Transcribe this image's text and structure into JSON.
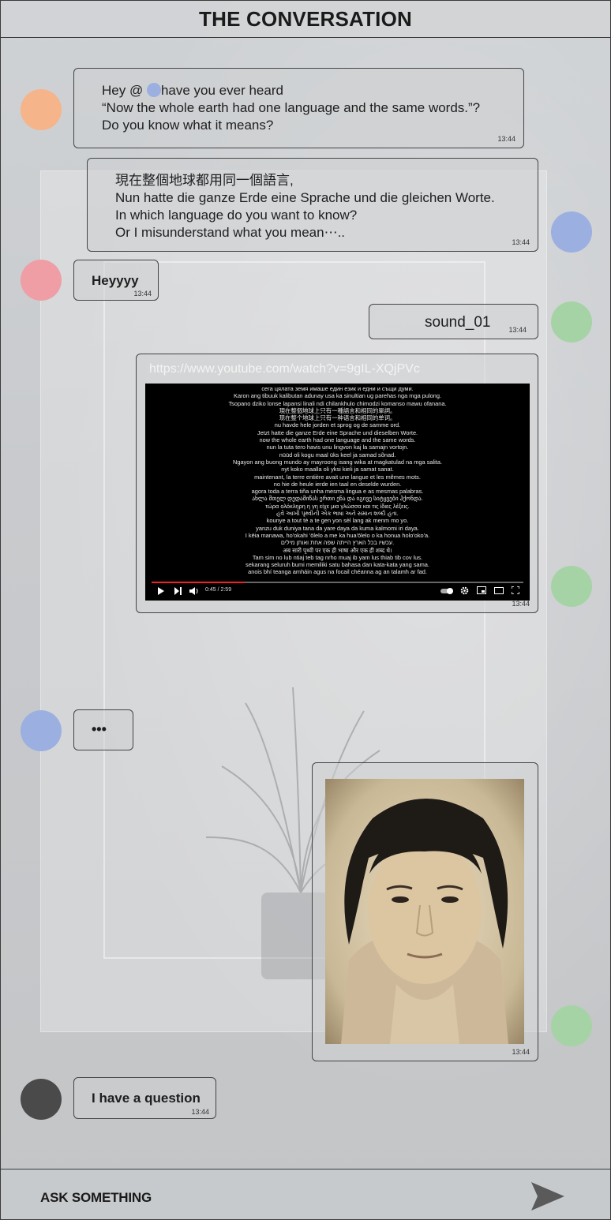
{
  "header": {
    "title": "THE CONVERSATION"
  },
  "messages": [
    {
      "time": "13:44",
      "lines": [
        "Hey @ ",
        "have you ever heard",
        "“Now the whole earth had one language and the same words.”?",
        "Do you know what it means?"
      ]
    },
    {
      "time": "13:44",
      "lines": [
        "現在整個地球都用同一個語言,",
        "Nun hatte die ganze Erde eine Sprache und die gleichen Worte.",
        "In which language do you want to know?",
        "Or I misunderstand what you mean⋯.."
      ]
    },
    {
      "time": "13:44",
      "text": "Heyyyy"
    },
    {
      "time": "13:44",
      "text": "sound_01"
    },
    {
      "time": "13:44",
      "url": "https://www.youtube.com/watch?v=9gIL-XQjPVc",
      "video_lines": [
        "сега цялата земя имаше един език и едни и същи думи.",
        "Karon ang tibuuk kalibutan adunay usa ka sinultian ug parehas nga mga pulong.",
        "Tsopano dziko lonse lapansi linali ndi chilankhulo chimodzi komanso mawu ofanana.",
        "現在整個地球上只有一種語言和相同的單詞。",
        "现在整个地球上只有一种语言和相同的单词。",
        "nu havde hele jorden et sprog og de samme ord.",
        "Jetzt hatte die ganze Erde eine Sprache und dieselben Worte.",
        "now the whole earth had one language and the same words.",
        "nun la tuta tero havis unu lingvon kaj la samajn vortojn.",
        "nüüd oli kogu maal üks keel ja samad sõnad.",
        "Ngayon ang buong mundo ay mayroong isang wika at magkatulad na mga salita.",
        "nyt koko maalla oli yksi kieli ja samat sanat.",
        "maintenant, la terre entière avait une langue et les mêmes mots.",
        "no hie de heule ierde ien taal en deselde wurden.",
        "agora toda a terra tiña unha mesma lingua e as mesmas palabras.",
        "ახლა მთელ დედამიწას ერთი ენა და იგივე სიტყვები ჰქონდა.",
        "τώρα ολόκληρη η γη είχε μια γλώσσα και τις ίδιες λέξεις.",
        "હવે આખી પૃથ્વીની એક ભાષા અને સમાન શબ્દો હતા.",
        "kounye a tout tè a te gen yon sèl lang ak menm mo yo.",
        "yanzu duk duniya tana da yare daya da kuma kalmomi iri daya.",
        "I kēia manawa, ho'okahi 'ōlelo a me ka hua'ōlelo o ka honua holo'oko'a.",
        "עכשיו בכל הארץ הייתה שפה אחת ואותן מילים.",
        "अब सारी पृथ्वी पर एक ही भाषा और एक ही शब्द थे।",
        "Tam sim no lub ntiaj teb tag nrho muaj ib yam lus thiab tib cov lus.",
        "sekarang seluruh bumi memiliki satu bahasa dan kata-kata yang sama.",
        "anois bhí teanga amháin agus na focail chéanna ag an talamh ar fad."
      ],
      "video_time": "0:45 / 2:59",
      "video_progress": 0.25
    },
    {
      "text": "•••"
    },
    {
      "time": "13:44"
    },
    {
      "time": "13:44",
      "text": "I have a question"
    }
  ],
  "footer": {
    "placeholder": "ASK SOMETHING"
  },
  "colors": {
    "avatar_orange": "#f6b48a",
    "avatar_blue": "#9bb0e0",
    "avatar_pink": "#ef9ea5",
    "avatar_green": "#a6d3a6",
    "avatar_dark": "#4a4a4a",
    "send_arrow": "#5a5a5a"
  },
  "icons": [
    "send-arrow-icon",
    "play-icon",
    "next-icon",
    "volume-icon",
    "autoplay-toggle-icon",
    "settings-icon",
    "miniplayer-icon",
    "theater-icon",
    "fullscreen-icon"
  ]
}
